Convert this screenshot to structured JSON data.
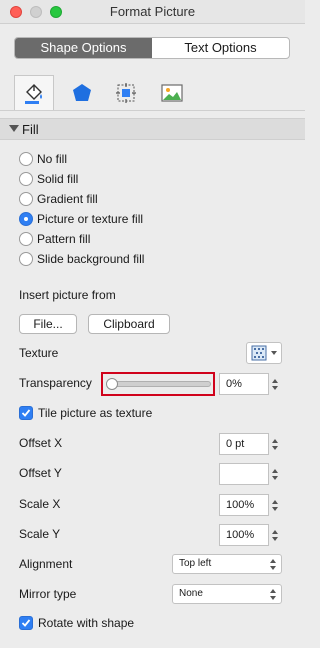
{
  "window": {
    "title": "Format Picture"
  },
  "segments": {
    "shape_options": "Shape Options",
    "text_options": "Text Options"
  },
  "tabs": {
    "active": "fill-line",
    "items": [
      "paint-bucket-icon",
      "pentagon-icon",
      "size-properties-icon",
      "picture-icon"
    ]
  },
  "section": {
    "label": "Fill",
    "expanded": true
  },
  "fill_options": [
    {
      "label": "No fill",
      "selected": false
    },
    {
      "label": "Solid fill",
      "selected": false
    },
    {
      "label": "Gradient fill",
      "selected": false
    },
    {
      "label": "Picture or texture fill",
      "selected": true
    },
    {
      "label": "Pattern fill",
      "selected": false
    },
    {
      "label": "Slide background fill",
      "selected": false
    }
  ],
  "insert": {
    "label": "Insert picture from",
    "file_button": "File...",
    "clipboard_button": "Clipboard"
  },
  "texture": {
    "label": "Texture"
  },
  "transparency": {
    "label": "Transparency",
    "value": "0%",
    "level": 0
  },
  "tile": {
    "label": "Tile picture as texture",
    "checked": true
  },
  "offset_x": {
    "label": "Offset X",
    "value": "0 pt"
  },
  "offset_y": {
    "label": "Offset Y",
    "value": ""
  },
  "scale_x": {
    "label": "Scale X",
    "value": "100%"
  },
  "scale_y": {
    "label": "Scale Y",
    "value": "100%"
  },
  "alignment": {
    "label": "Alignment",
    "value": "Top left"
  },
  "mirror": {
    "label": "Mirror type",
    "value": "None"
  },
  "rotate": {
    "label": "Rotate with shape",
    "checked": true
  },
  "colors": {
    "accent": "#2f7ff3",
    "highlight_box": "#d0021b",
    "close": "#ff5f57",
    "minimize": "#febc2e",
    "maximize": "#28c840"
  }
}
